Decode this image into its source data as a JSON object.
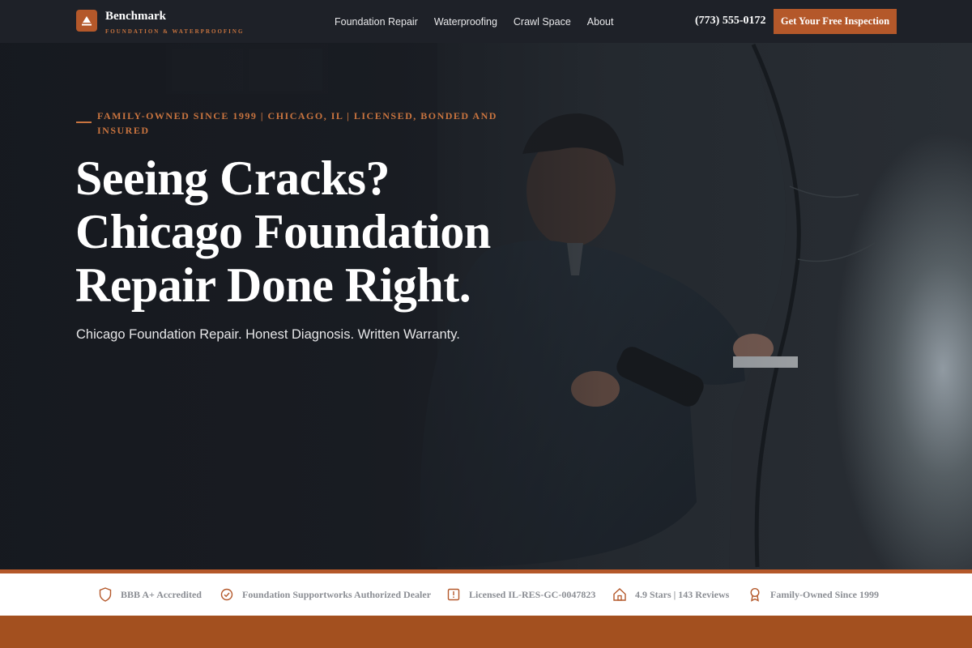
{
  "nav": {
    "brand_name": "Benchmark",
    "brand_tagline": "FOUNDATION & WATERPROOFING",
    "links": [
      "Foundation Repair",
      "Waterproofing",
      "Crawl Space",
      "About"
    ],
    "phone": "(773) 555-0172",
    "cta_label": "Get Your Free Inspection"
  },
  "hero": {
    "eyebrow": "FAMILY-OWNED SINCE 1999 | CHICAGO, IL | LICENSED, BONDED AND INSURED",
    "headline": "Seeing Cracks? Chicago Foundation Repair Done Right.",
    "subheadline": "Chicago Foundation Repair. Honest Diagnosis. Written Warranty.",
    "image": "technician-inspecting-basement-wall-crack"
  },
  "trust_bar": {
    "items": [
      {
        "label": "BBB A+ Accredited",
        "icon": "shield-icon"
      },
      {
        "label": "Foundation Supportworks Authorized Dealer",
        "icon": "check-circle-icon"
      },
      {
        "label": "Licensed IL-RES-GC-0047823",
        "icon": "license-icon"
      },
      {
        "label": "4.9 Stars | 143 Reviews",
        "icon": "house-icon"
      },
      {
        "label": "Family-Owned Since 1999",
        "icon": "award-icon"
      }
    ]
  },
  "colors": {
    "accent": "#b4582a",
    "accent_text": "#c9743f",
    "nav_bg": "#1e2128",
    "bottom_band": "#a3501f"
  }
}
